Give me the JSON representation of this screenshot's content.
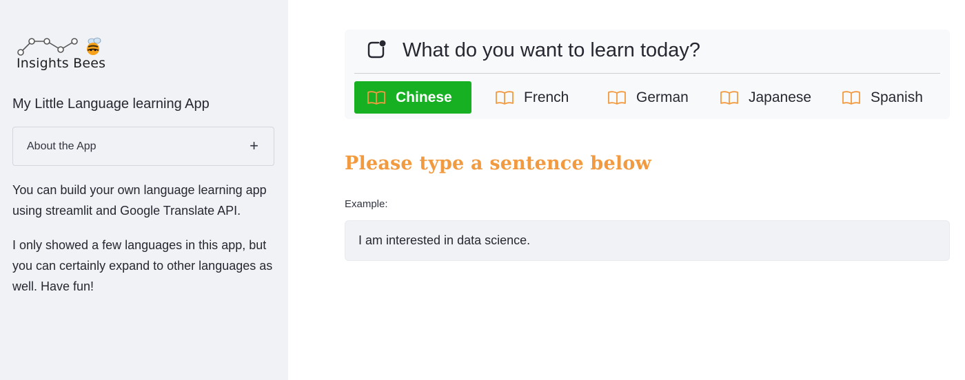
{
  "sidebar": {
    "logo": {
      "text": "Insights Bees",
      "icon": "bee-chart-logo"
    },
    "title": "My Little Language learning App",
    "expander": {
      "label": "About the App",
      "icon": "plus-icon"
    },
    "paragraphs": [
      "You can build your own language learning app using streamlit and Google Translate API.",
      "I only showed a few languages in this app, but you can certainly expand to other languages as well. Have fun!"
    ]
  },
  "menu": {
    "title": "What do you want to learn today?",
    "icon": "app-indicator-icon",
    "tabs": [
      {
        "label": "Chinese",
        "icon": "book-icon",
        "active": true
      },
      {
        "label": "French",
        "icon": "book-icon",
        "active": false
      },
      {
        "label": "German",
        "icon": "book-icon",
        "active": false
      },
      {
        "label": "Japanese",
        "icon": "book-icon",
        "active": false
      },
      {
        "label": "Spanish",
        "icon": "book-icon",
        "active": false
      }
    ]
  },
  "main": {
    "heading": "Please type a sentence below",
    "input_label": "Example:",
    "input_value": "I am interested in data science."
  },
  "colors": {
    "active_tab": "#17b023",
    "heading": "#f29a3f",
    "book_icon": "#f29a3f",
    "sidebar_bg": "#f0f2f6"
  }
}
